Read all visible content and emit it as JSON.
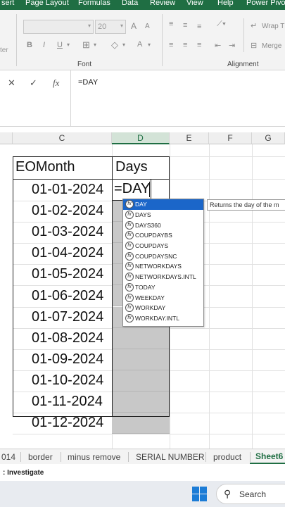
{
  "ribbon_tabs": [
    "sert",
    "Page Layout",
    "Formulas",
    "Data",
    "Review",
    "View",
    "Help",
    "Power Pivot"
  ],
  "ribbon": {
    "font_name": "",
    "font_size": "20",
    "bold": "B",
    "italic": "I",
    "underline": "U",
    "grow_font": "A",
    "shrink_font": "A",
    "font_color": "A",
    "wrap_text": "Wrap T",
    "merge": "Merge",
    "font_group_label": "Font",
    "alignment_group_label": "Alignment",
    "clipboard_fragment": "ter"
  },
  "formula_bar": {
    "cancel": "✕",
    "enter": "✓",
    "fx": "fx",
    "formula": "=DAY"
  },
  "columns": [
    "C",
    "D",
    "E",
    "F",
    "G"
  ],
  "table": {
    "header_c": "EOMonth",
    "header_d": "Days",
    "editing_cell": "=DAY",
    "dates": [
      "01-01-2024",
      "01-02-2024",
      "01-03-2024",
      "01-04-2024",
      "01-05-2024",
      "01-06-2024",
      "01-07-2024",
      "01-08-2024",
      "01-09-2024",
      "01-10-2024",
      "01-11-2024",
      "01-12-2024"
    ]
  },
  "autocomplete": {
    "items": [
      "DAY",
      "DAYS",
      "DAYS360",
      "COUPDAYBS",
      "COUPDAYS",
      "COUPDAYSNC",
      "NETWORKDAYS",
      "NETWORKDAYS.INTL",
      "TODAY",
      "WEEKDAY",
      "WORKDAY",
      "WORKDAY.INTL"
    ],
    "icon_label": "fx",
    "tooltip": "Returns the day of the m"
  },
  "sheet_tabs": [
    "014",
    "border",
    "minus remove",
    "SERIAL NUMBER",
    "product",
    "Sheet6"
  ],
  "status": ": Investigate",
  "taskbar": {
    "search": "Search"
  },
  "colors": {
    "accent": "#1f6e43",
    "selection": "#1b66c9",
    "grey_fill": "#c8c8c8"
  }
}
